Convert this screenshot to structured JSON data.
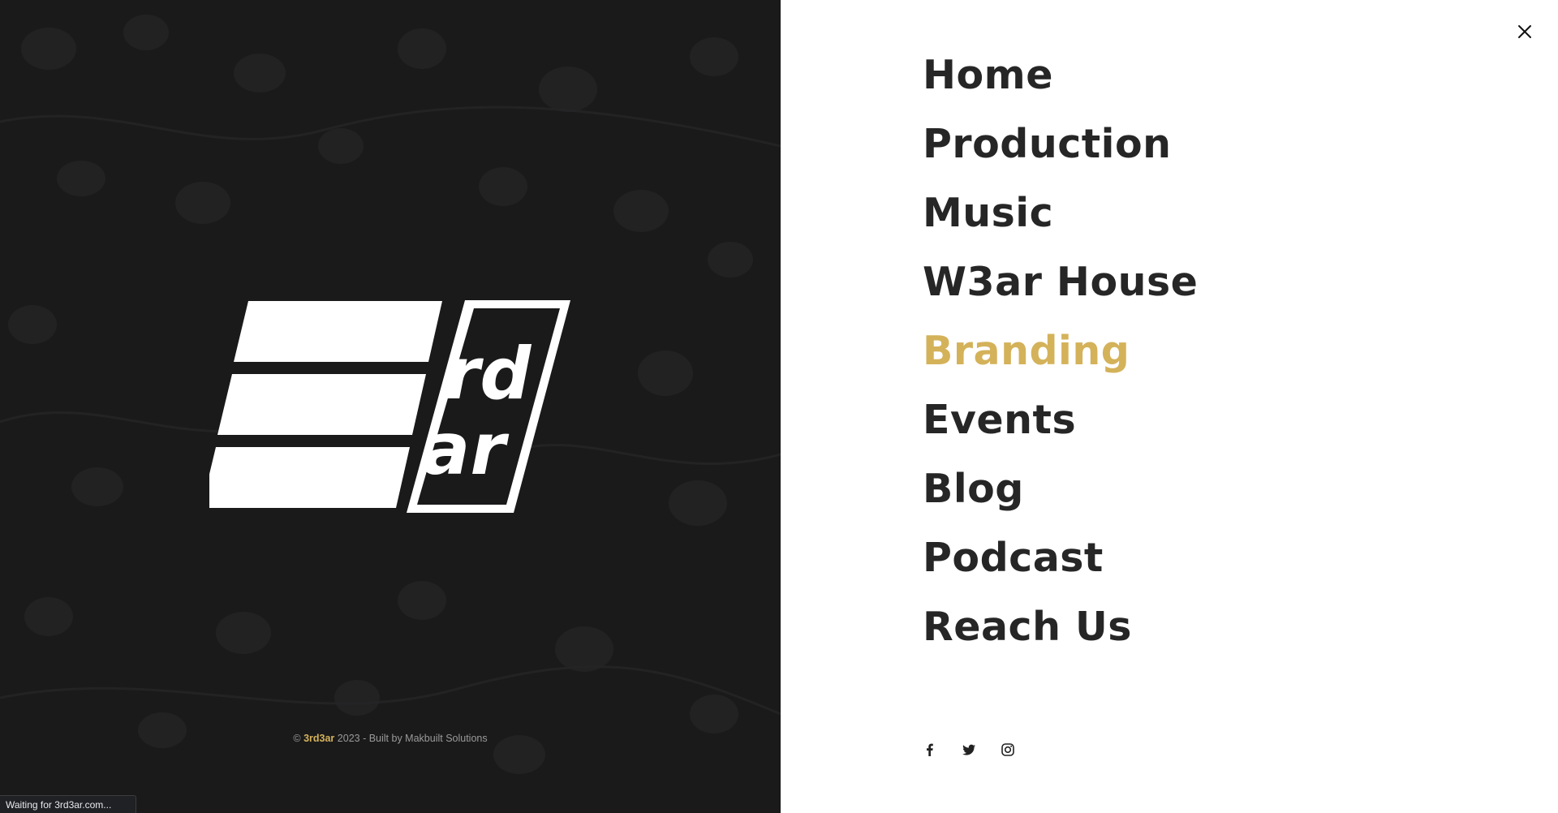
{
  "left_panel": {
    "background_color": "#1a1a1b",
    "logo": {
      "name": "3rd3ar-logo",
      "text_top": "rd",
      "text_bottom": "ar"
    },
    "copyright": {
      "prefix": "©",
      "brand": "3rd3ar",
      "suffix": "2023 - Built by Makbuilt Solutions"
    }
  },
  "status_bar": {
    "text": "Waiting for 3rd3ar.com..."
  },
  "menu": {
    "close_icon": "close-icon",
    "items": [
      {
        "label": "Home",
        "active": false
      },
      {
        "label": "Production",
        "active": false
      },
      {
        "label": "Music",
        "active": false
      },
      {
        "label": "W3ar House",
        "active": false
      },
      {
        "label": "Branding",
        "active": true
      },
      {
        "label": "Events",
        "active": false
      },
      {
        "label": "Blog",
        "active": false
      },
      {
        "label": "Podcast",
        "active": false
      },
      {
        "label": "Reach Us",
        "active": false
      }
    ],
    "social_icons": [
      "facebook-icon",
      "twitter-icon",
      "instagram-icon"
    ]
  },
  "colors": {
    "accent": "#d4b25a",
    "text_dark": "#262626"
  }
}
